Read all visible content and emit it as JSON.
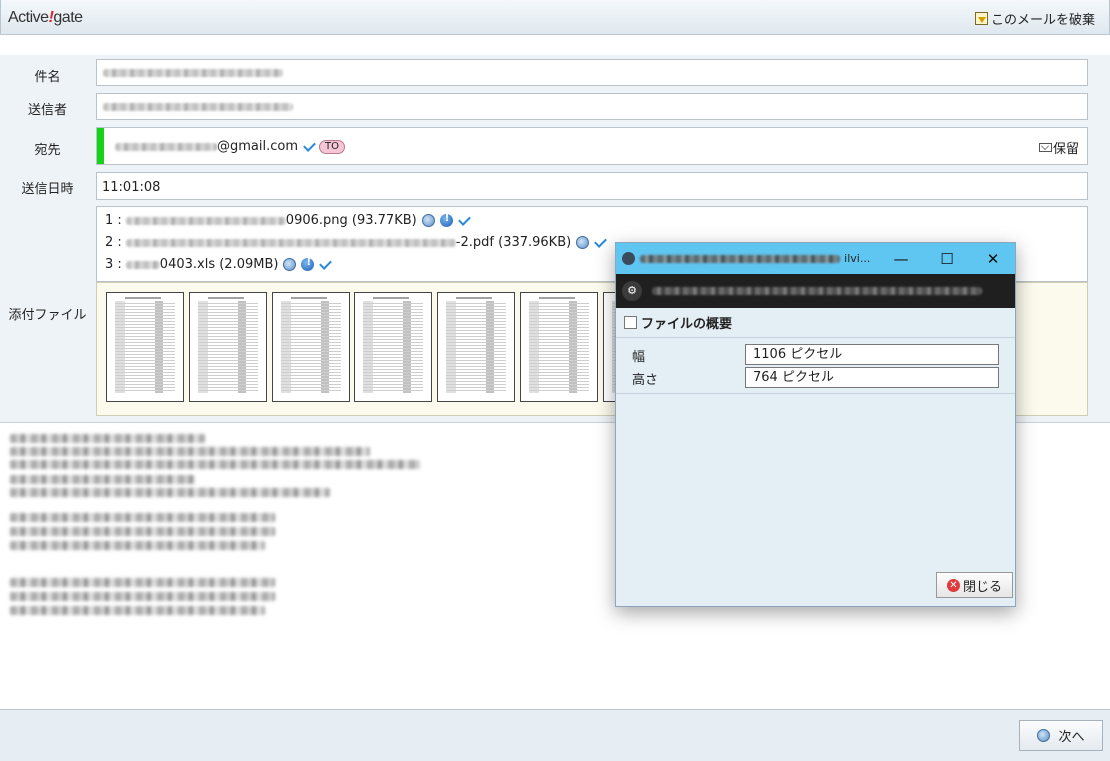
{
  "header": {
    "logo_text": "Active",
    "logo_mark": "!",
    "logo_suffix": "gate",
    "discard_label": "このメールを破棄"
  },
  "form": {
    "subject_label": "件名",
    "sender_label": "送信者",
    "recipient_label": "宛先",
    "recipient_domain": "@gmail.com",
    "to_badge": "TO",
    "hold_label": "保留",
    "sent_time_label": "送信日時",
    "sent_time": "11:01:08",
    "attachment_label": "添付ファイル"
  },
  "attachments": [
    {
      "index": "1 :",
      "name_suffix": "0906.png",
      "size": "(93.77KB)"
    },
    {
      "index": "2 :",
      "name_suffix": "-2.pdf",
      "size": "(337.96KB)"
    },
    {
      "index": "3 :",
      "name_suffix": "0403.xls",
      "size": "(2.09MB)"
    }
  ],
  "footer": {
    "next_label": "次へ"
  },
  "dialog": {
    "heading": "ファイルの概要",
    "width_label": "幅",
    "width_value": "1106 ピクセル",
    "height_label": "高さ",
    "height_value": "764 ピクセル",
    "close_label": "閉じる",
    "title_suffix": "ilvi..."
  },
  "icons": {
    "discard": "discard-icon",
    "check": "check-icon",
    "hold": "envelope-icon",
    "preview": "search-icon",
    "info": "info-icon",
    "close": "close-icon"
  }
}
